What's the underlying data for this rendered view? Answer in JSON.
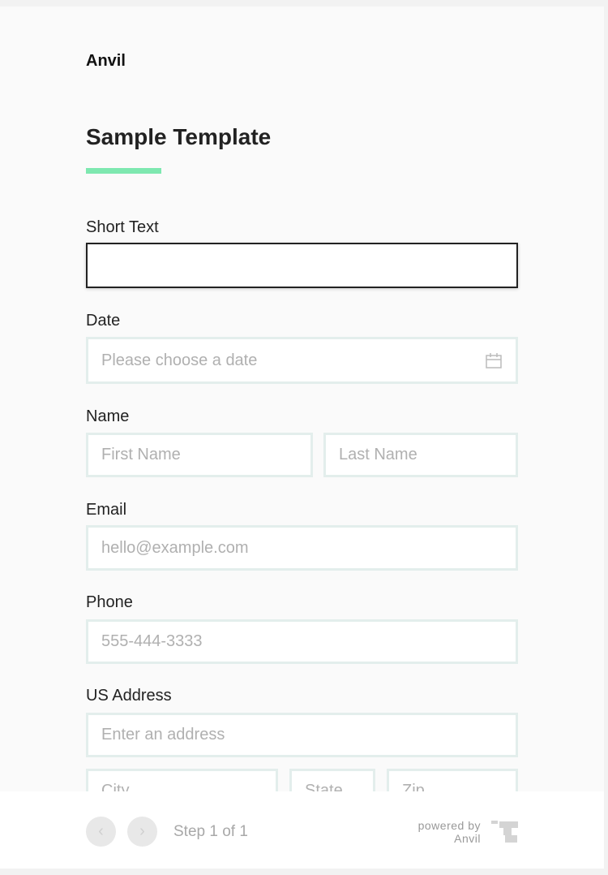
{
  "brand": "Anvil",
  "title": "Sample Template",
  "accent_color": "#7ee8b0",
  "fields": {
    "short_text": {
      "label": "Short Text",
      "value": ""
    },
    "date": {
      "label": "Date",
      "placeholder": "Please choose a date",
      "icon": "calendar-icon"
    },
    "name": {
      "label": "Name",
      "first_placeholder": "First Name",
      "last_placeholder": "Last Name"
    },
    "email": {
      "label": "Email",
      "placeholder": "hello@example.com"
    },
    "phone": {
      "label": "Phone",
      "placeholder": "555-444-3333"
    },
    "address": {
      "label": "US Address",
      "placeholder": "Enter an address",
      "city_placeholder": "City",
      "state_placeholder": "State",
      "zip_placeholder": "Zip"
    }
  },
  "footer": {
    "prev_icon": "chevron-left-icon",
    "next_icon": "chevron-right-icon",
    "step_text": "Step 1 of 1",
    "powered_by": "powered by",
    "powered_brand": "Anvil"
  }
}
